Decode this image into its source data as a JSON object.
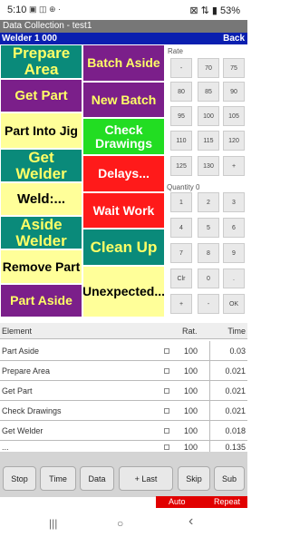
{
  "status": {
    "time": "5:10",
    "icons": "▣ ◫ ⊕ ·",
    "right": "⊠ ⇅ ▮ 53%"
  },
  "title": "Data Collection - test1",
  "subbar": {
    "left": "Welder 1  000",
    "right": "Back"
  },
  "buttons": {
    "prepare_area": "Prepare Area",
    "get_part": "Get Part",
    "part_into_jig": "Part Into Jig",
    "get_welder": "Get Welder",
    "weld": "Weld:...",
    "aside_welder": "Aside Welder",
    "remove_part": "Remove Part",
    "part_aside": "Part Aside",
    "batch_aside": "Batch Aside",
    "new_batch": "New Batch",
    "check_drawings": "Check Drawings",
    "delays": "Delays...",
    "wait_work": "Wait Work",
    "clean_up": "Clean Up",
    "unexpected": "Unexpected..."
  },
  "rate": {
    "label": "Rate",
    "keys": [
      "-",
      "70",
      "75",
      "80",
      "85",
      "90",
      "95",
      "100",
      "105",
      "110",
      "115",
      "120",
      "125",
      "130",
      "+"
    ]
  },
  "quantity": {
    "label": "Quantity 0",
    "keys": [
      "1",
      "2",
      "3",
      "4",
      "5",
      "6",
      "7",
      "8",
      "9",
      "Clr",
      "0",
      ".",
      "+",
      "-",
      "OK"
    ]
  },
  "table": {
    "headers": [
      "Element",
      "Rat.",
      "Time"
    ],
    "rows": [
      {
        "element": "Part Aside",
        "rate": "100",
        "time": "0.03"
      },
      {
        "element": "Prepare Area",
        "rate": "100",
        "time": "0.021"
      },
      {
        "element": "Get Part",
        "rate": "100",
        "time": "0.021"
      },
      {
        "element": "Check Drawings",
        "rate": "100",
        "time": "0.021"
      },
      {
        "element": "Get Welder",
        "rate": "100",
        "time": "0.018"
      },
      {
        "element": "...",
        "rate": "100",
        "time": "0.135"
      }
    ]
  },
  "toolbar": [
    "Stop",
    "Time",
    "Data",
    "+ Last",
    "Skip",
    "Sub"
  ],
  "footer": {
    "auto": "Auto",
    "repeat": "Repeat"
  },
  "nav": {
    "recents": "|||",
    "home": "○",
    "back": "‹"
  },
  "colors": {
    "teal": "#0a8a7a",
    "purple": "#7b1f8a",
    "yellow": "#ffff99",
    "red": "#ff1a1a",
    "green": "#22dd22",
    "blue": "#0a1fb0"
  }
}
